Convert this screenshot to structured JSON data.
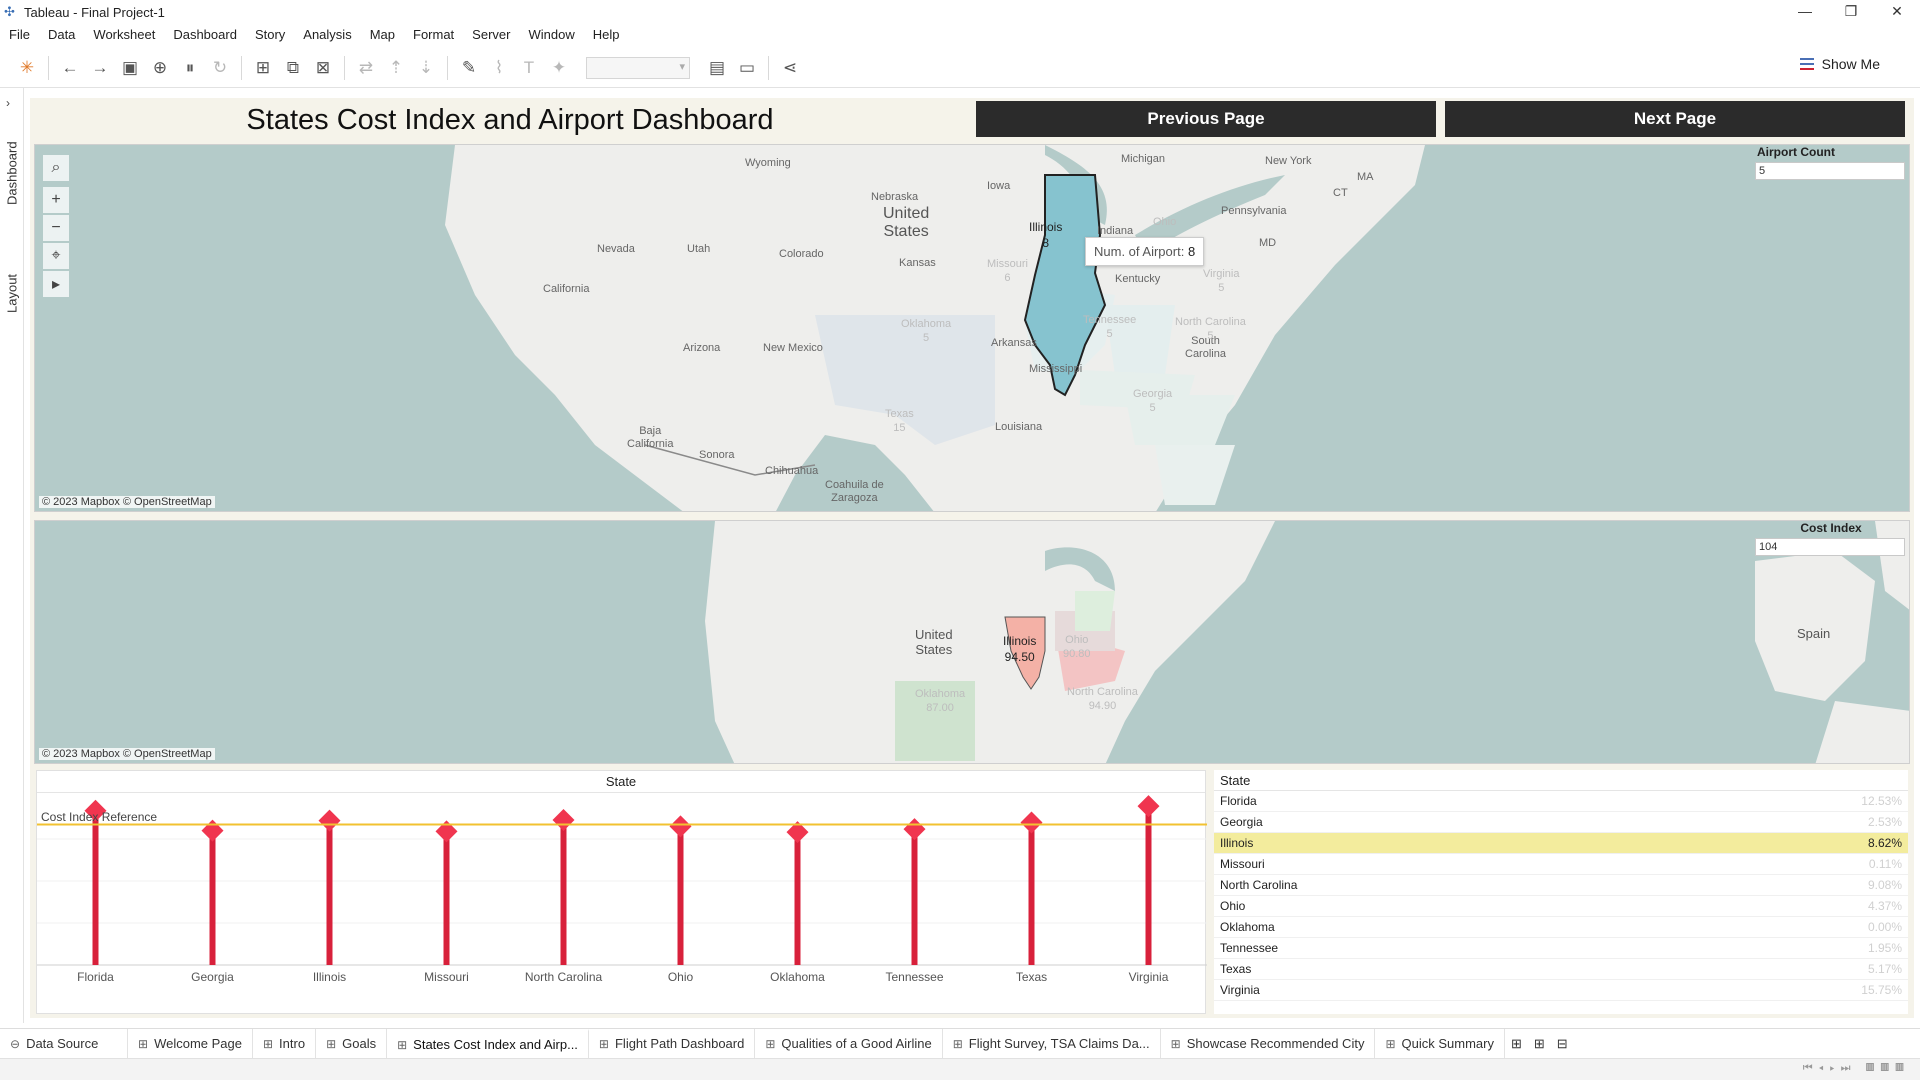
{
  "window": {
    "title": "Tableau - Final Project-1",
    "controls": [
      "—",
      "❐",
      "✕"
    ]
  },
  "menu": [
    "File",
    "Data",
    "Worksheet",
    "Dashboard",
    "Story",
    "Analysis",
    "Map",
    "Format",
    "Server",
    "Window",
    "Help"
  ],
  "toolbar": {
    "show_me": "Show Me"
  },
  "side_tabs": {
    "dashboard": "Dashboard",
    "layout": "Layout"
  },
  "dashboard": {
    "title": "States Cost Index and Airport Dashboard",
    "prev_button": "Previous Page",
    "next_button": "Next Page"
  },
  "map_top": {
    "credit": "© 2023 Mapbox © OpenStreetMap",
    "filter_label": "Airport Count",
    "filter_value": "5",
    "labels": {
      "wyoming": "Wyoming",
      "michigan": "Michigan",
      "new_york": "New York",
      "nebraska": "Nebraska",
      "iowa": "Iowa",
      "ma": "MA",
      "ct": "CT",
      "pennsylvania": "Pennsylvania",
      "united_states": "United\nStates",
      "nevada": "Nevada",
      "utah": "Utah",
      "colorado": "Colorado",
      "indiana": "Indiana",
      "md": "MD",
      "kansas": "Kansas",
      "kentucky": "Kentucky",
      "california": "California",
      "arizona": "Arizona",
      "new_mexico": "New Mexico",
      "arkansas": "Arkansas",
      "mississippi": "Mississippi",
      "south_carolina": "South\nCarolina",
      "louisiana": "Louisiana",
      "baja_california": "Baja\nCalifornia",
      "sonora": "Sonora",
      "chihuahua": "Chihuahua",
      "coahuila": "Coahuila de\nZaragoza",
      "ohio": "Ohio",
      "missouri": "Missouri\n6",
      "virginia": "Virginia\n5",
      "oklahoma": "Oklahoma\n5",
      "tennessee": "Tennessee\n5",
      "north_carolina": "North Carolina\n5",
      "georgia": "Georgia\n5",
      "texas": "Texas\n15",
      "illinois": "Illinois\n8"
    },
    "tooltip_label": "Num. of Airport:",
    "tooltip_value": "8"
  },
  "map_bottom": {
    "credit": "© 2023 Mapbox © OpenStreetMap",
    "filter_label": "Cost Index",
    "filter_value": "104",
    "labels": {
      "united_states": "United\nStates",
      "spain": "Spain",
      "illinois": "Illinois\n94.50",
      "ohio": "Ohio\n90.80",
      "oklahoma": "Oklahoma\n87.00",
      "north_carolina": "North Carolina\n94.90"
    }
  },
  "chart_data": {
    "type": "bar",
    "title": "State",
    "categories": [
      "Florida",
      "Georgia",
      "Illinois",
      "Missouri",
      "North Carolina",
      "Ohio",
      "Oklahoma",
      "Tennessee",
      "Texas",
      "Virginia"
    ],
    "values": [
      101.0,
      88.0,
      94.5,
      87.5,
      94.9,
      90.8,
      87.0,
      89.0,
      93.3,
      104.0
    ],
    "reference_line": {
      "label": "Cost Index Reference",
      "value": 92,
      "color": "#f2c230"
    },
    "ylim": [
      0,
      110
    ],
    "colors": {
      "stem": "#d8213b",
      "marker": "#f0354f"
    }
  },
  "state_table": {
    "header": "State",
    "rows": [
      {
        "state": "Florida",
        "pct": "12.53%"
      },
      {
        "state": "Georgia",
        "pct": "2.53%"
      },
      {
        "state": "Illinois",
        "pct": "8.62%",
        "selected": true
      },
      {
        "state": "Missouri",
        "pct": "0.11%"
      },
      {
        "state": "North Carolina",
        "pct": "9.08%"
      },
      {
        "state": "Ohio",
        "pct": "4.37%"
      },
      {
        "state": "Oklahoma",
        "pct": "0.00%"
      },
      {
        "state": "Tennessee",
        "pct": "1.95%"
      },
      {
        "state": "Texas",
        "pct": "5.17%"
      },
      {
        "state": "Virginia",
        "pct": "15.75%"
      }
    ]
  },
  "sheet_tabs": {
    "data_source": "Data Source",
    "items": [
      "Welcome Page",
      "Intro",
      "Goals",
      "States Cost Index and Airp...",
      "Flight Path Dashboard",
      "Qualities of a Good Airline",
      "Flight Survey, TSA Claims Da...",
      "Showcase Recommended City",
      "Quick Summary"
    ],
    "active_index": 3
  }
}
